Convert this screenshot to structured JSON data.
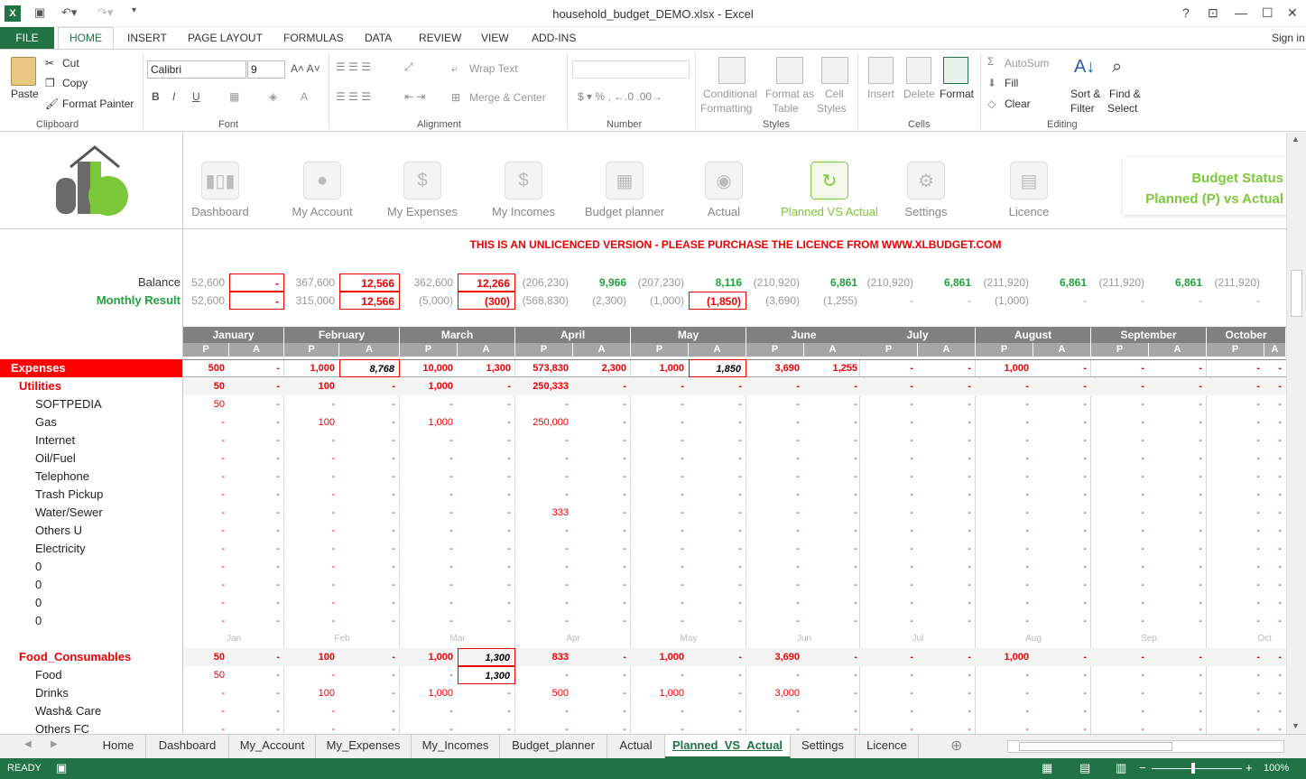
{
  "window": {
    "title": "household_budget_DEMO.xlsx - Excel",
    "help": "?",
    "min": "—",
    "max": "☐",
    "close": "✕",
    "sign_in": "Sign in"
  },
  "ribbon_tabs": {
    "file": "FILE",
    "home": "HOME",
    "insert": "INSERT",
    "page_layout": "PAGE LAYOUT",
    "formulas": "FORMULAS",
    "data": "DATA",
    "review": "REVIEW",
    "view": "VIEW",
    "addins": "ADD-INS"
  },
  "ribbon": {
    "paste": "Paste",
    "cut": "Cut",
    "copy": "Copy",
    "format_painter": "Format Painter",
    "clipboard": "Clipboard",
    "font_name": "Calibri",
    "font_size": "9",
    "font_group": "Font",
    "wrap_text": "Wrap Text",
    "merge_center": "Merge & Center",
    "alignment": "Alignment",
    "number": "Number",
    "cond_format_1": "Conditional",
    "cond_format_2": "Formatting",
    "format_table_1": "Format as",
    "format_table_2": "Table",
    "cell_styles_1": "Cell",
    "cell_styles_2": "Styles",
    "styles": "Styles",
    "insert": "Insert",
    "delete": "Delete",
    "format": "Format",
    "cells": "Cells",
    "autosum": "AutoSum",
    "fill": "Fill",
    "clear": "Clear",
    "sort_1": "Sort &",
    "sort_2": "Filter",
    "find_1": "Find &",
    "find_2": "Select",
    "editing": "Editing"
  },
  "nav": [
    {
      "label": "Dashboard",
      "icon": "bar-chart-icon"
    },
    {
      "label": "My Account",
      "icon": "user-icon"
    },
    {
      "label": "My Expenses",
      "icon": "expense-icon"
    },
    {
      "label": "My Incomes",
      "icon": "income-icon"
    },
    {
      "label": "Budget planner",
      "icon": "calculator-icon"
    },
    {
      "label": "Actual",
      "icon": "coin-icon"
    },
    {
      "label": "Planned VS Actual",
      "icon": "refresh-icon"
    },
    {
      "label": "Settings",
      "icon": "gear-icon"
    },
    {
      "label": "Licence",
      "icon": "document-icon"
    }
  ],
  "status_box": {
    "line1": "Budget Status",
    "line2": "Planned (P) vs Actual"
  },
  "warning": "THIS IS AN UNLICENCED VERSION - PLEASE PURCHASE THE LICENCE FROM WWW.XLBUDGET.COM",
  "labels": {
    "balance": "Balance",
    "monthly_result": "Monthly Result"
  },
  "months": [
    "January",
    "February",
    "March",
    "April",
    "May",
    "June",
    "July",
    "August",
    "September",
    "October"
  ],
  "months_short": [
    "Jan",
    "Feb",
    "Mar",
    "Apr",
    "May",
    "Jun",
    "Jul",
    "Aug",
    "Sep",
    "Oct"
  ],
  "pa": {
    "p": "P",
    "a": "A"
  },
  "balance": [
    "52,600",
    "-",
    "367,600",
    "12,566",
    "362,600",
    "12,266",
    "(206,230)",
    "9,966",
    "(207,230)",
    "8,116",
    "(210,920)",
    "6,861",
    "(210,920)",
    "6,861",
    "(211,920)",
    "6,861",
    "(211,920)",
    "6,861",
    "(211,920)",
    ""
  ],
  "monthly": [
    "52,600",
    "-",
    "315,000",
    "12,566",
    "(5,000)",
    "(300)",
    "(568,830)",
    "(2,300)",
    "(1,000)",
    "(1,850)",
    "(3,690)",
    "(1,255)",
    "-",
    "-",
    "(1,000)",
    "-",
    "-",
    "-",
    "-",
    ""
  ],
  "rows": [
    {
      "label": "Expenses",
      "type": "head",
      "v": [
        "500",
        "-",
        "1,000",
        "8,768",
        "10,000",
        "1,300",
        "573,830",
        "2,300",
        "1,000",
        "1,850",
        "3,690",
        "1,255",
        "-",
        "-",
        "1,000",
        "-",
        "-",
        "-",
        "-",
        "-"
      ]
    },
    {
      "label": "Utilities",
      "type": "cat",
      "v": [
        "50",
        "-",
        "100",
        "-",
        "1,000",
        "-",
        "250,333",
        "-",
        "-",
        "-",
        "-",
        "-",
        "-",
        "-",
        "-",
        "-",
        "-",
        "-",
        "-",
        "-"
      ]
    },
    {
      "label": "SOFTPEDIA",
      "type": "item",
      "v": [
        "50",
        "-",
        "-",
        "-",
        "-",
        "-",
        "-",
        "-",
        "-",
        "-",
        "-",
        "-",
        "-",
        "-",
        "-",
        "-",
        "-",
        "-",
        "-",
        "-"
      ]
    },
    {
      "label": "Gas",
      "type": "item",
      "v": [
        "-",
        "-",
        "100",
        "-",
        "1,000",
        "-",
        "250,000",
        "-",
        "-",
        "-",
        "-",
        "-",
        "-",
        "-",
        "-",
        "-",
        "-",
        "-",
        "-",
        "-"
      ]
    },
    {
      "label": "Internet",
      "type": "item",
      "v": [
        "-",
        "-",
        "-",
        "-",
        "-",
        "-",
        "-",
        "-",
        "-",
        "-",
        "-",
        "-",
        "-",
        "-",
        "-",
        "-",
        "-",
        "-",
        "-",
        "-"
      ]
    },
    {
      "label": "Oil/Fuel",
      "type": "item",
      "v": [
        "-",
        "-",
        "-",
        "-",
        "-",
        "-",
        "-",
        "-",
        "-",
        "-",
        "-",
        "-",
        "-",
        "-",
        "-",
        "-",
        "-",
        "-",
        "-",
        "-"
      ]
    },
    {
      "label": "Telephone",
      "type": "item",
      "v": [
        "-",
        "-",
        "-",
        "-",
        "-",
        "-",
        "-",
        "-",
        "-",
        "-",
        "-",
        "-",
        "-",
        "-",
        "-",
        "-",
        "-",
        "-",
        "-",
        "-"
      ]
    },
    {
      "label": "Trash Pickup",
      "type": "item",
      "v": [
        "-",
        "-",
        "-",
        "-",
        "-",
        "-",
        "-",
        "-",
        "-",
        "-",
        "-",
        "-",
        "-",
        "-",
        "-",
        "-",
        "-",
        "-",
        "-",
        "-"
      ]
    },
    {
      "label": "Water/Sewer",
      "type": "item",
      "v": [
        "-",
        "-",
        "-",
        "-",
        "-",
        "-",
        "333",
        "-",
        "-",
        "-",
        "-",
        "-",
        "-",
        "-",
        "-",
        "-",
        "-",
        "-",
        "-",
        "-"
      ]
    },
    {
      "label": "Others U",
      "type": "item",
      "v": [
        "-",
        "-",
        "-",
        "-",
        "-",
        "-",
        "-",
        "-",
        "-",
        "-",
        "-",
        "-",
        "-",
        "-",
        "-",
        "-",
        "-",
        "-",
        "-",
        "-"
      ]
    },
    {
      "label": "Electricity",
      "type": "item",
      "v": [
        "-",
        "-",
        "-",
        "-",
        "-",
        "-",
        "-",
        "-",
        "-",
        "-",
        "-",
        "-",
        "-",
        "-",
        "-",
        "-",
        "-",
        "-",
        "-",
        "-"
      ]
    },
    {
      "label": "0",
      "type": "item",
      "v": [
        "-",
        "-",
        "-",
        "-",
        "-",
        "-",
        "-",
        "-",
        "-",
        "-",
        "-",
        "-",
        "-",
        "-",
        "-",
        "-",
        "-",
        "-",
        "-",
        "-"
      ]
    },
    {
      "label": "0",
      "type": "item",
      "v": [
        "-",
        "-",
        "-",
        "-",
        "-",
        "-",
        "-",
        "-",
        "-",
        "-",
        "-",
        "-",
        "-",
        "-",
        "-",
        "-",
        "-",
        "-",
        "-",
        "-"
      ]
    },
    {
      "label": "0",
      "type": "item",
      "v": [
        "-",
        "-",
        "-",
        "-",
        "-",
        "-",
        "-",
        "-",
        "-",
        "-",
        "-",
        "-",
        "-",
        "-",
        "-",
        "-",
        "-",
        "-",
        "-",
        "-"
      ]
    },
    {
      "label": "0",
      "type": "item",
      "v": [
        "-",
        "-",
        "-",
        "-",
        "-",
        "-",
        "-",
        "-",
        "-",
        "-",
        "-",
        "-",
        "-",
        "-",
        "-",
        "-",
        "-",
        "-",
        "-",
        "-"
      ]
    },
    {
      "label": "",
      "type": "months",
      "v": []
    },
    {
      "label": "Food_Consumables",
      "type": "cat",
      "v": [
        "50",
        "-",
        "100",
        "-",
        "1,000",
        "1,300",
        "833",
        "-",
        "1,000",
        "-",
        "3,690",
        "-",
        "-",
        "-",
        "1,000",
        "-",
        "-",
        "-",
        "-",
        "-"
      ]
    },
    {
      "label": "Food",
      "type": "item",
      "v": [
        "50",
        "-",
        "-",
        "-",
        "-",
        "1,300",
        "-",
        "-",
        "-",
        "-",
        "-",
        "-",
        "-",
        "-",
        "-",
        "-",
        "-",
        "-",
        "-",
        "-"
      ]
    },
    {
      "label": "Drinks",
      "type": "item",
      "v": [
        "-",
        "-",
        "100",
        "-",
        "1,000",
        "-",
        "500",
        "-",
        "1,000",
        "-",
        "3,000",
        "-",
        "-",
        "-",
        "-",
        "-",
        "-",
        "-",
        "-",
        "-"
      ]
    },
    {
      "label": "Wash& Care",
      "type": "item",
      "v": [
        "-",
        "-",
        "-",
        "-",
        "-",
        "-",
        "-",
        "-",
        "-",
        "-",
        "-",
        "-",
        "-",
        "-",
        "-",
        "-",
        "-",
        "-",
        "-",
        "-"
      ]
    },
    {
      "label": "Others FC",
      "type": "item",
      "v": [
        "-",
        "-",
        "-",
        "-",
        "-",
        "-",
        "-",
        "-",
        "-",
        "-",
        "-",
        "-",
        "-",
        "-",
        "-",
        "-",
        "-",
        "-",
        "-",
        "-"
      ]
    }
  ],
  "sheet_tabs": [
    "Home",
    "Dashboard",
    "My_Account",
    "My_Expenses",
    "My_Incomes",
    "Budget_planner",
    "Actual",
    "Planned_VS_Actual",
    "Settings",
    "Licence"
  ],
  "active_sheet": "Planned_VS_Actual",
  "status": {
    "ready": "READY",
    "zoom": "100%"
  },
  "colors": {
    "excel_green": "#217346",
    "accent_red": "#e00000",
    "accent_green": "#7dc83a"
  }
}
